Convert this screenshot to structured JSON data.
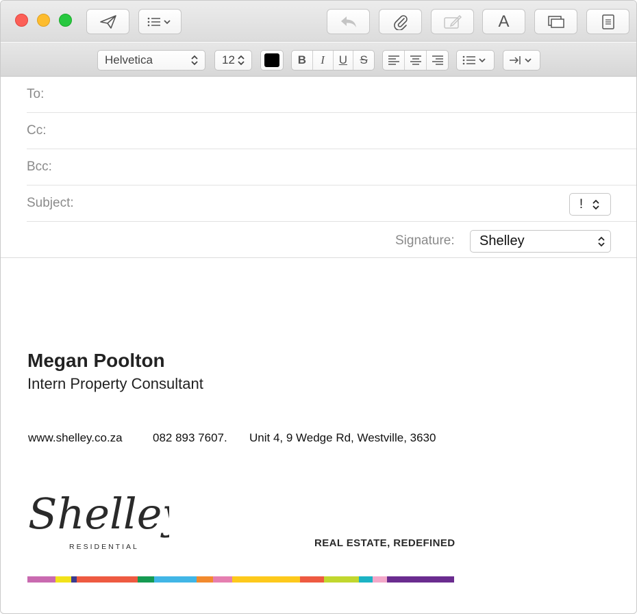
{
  "window": {
    "toolbar": {
      "buttons": [
        {
          "name": "send-button",
          "icon": "paper-plane-icon"
        },
        {
          "name": "header-fields-button",
          "icon": "list-icon"
        },
        {
          "name": "reply-button",
          "icon": "reply-arrow-icon"
        },
        {
          "name": "attach-button",
          "icon": "paperclip-icon"
        },
        {
          "name": "markup-button",
          "icon": "markup-icon"
        },
        {
          "name": "fonts-button",
          "icon": "font-a-icon"
        },
        {
          "name": "browse-photos-button",
          "icon": "photo-browser-icon"
        },
        {
          "name": "stationery-button",
          "icon": "stationery-icon"
        }
      ],
      "fonts_label": "A"
    }
  },
  "format": {
    "font": "Helvetica",
    "size": "12",
    "text_color": "#000000",
    "bold": "B",
    "italic": "I",
    "underline": "U",
    "strike": "S"
  },
  "header": {
    "to_label": "To:",
    "cc_label": "Cc:",
    "bcc_label": "Bcc:",
    "subject_label": "Subject:",
    "priority": "!",
    "signature_label": "Signature:",
    "signature_value": "Shelley"
  },
  "body": {
    "name": "Megan Poolton",
    "title": "Intern Property Consultant",
    "website": "www.shelley.co.za",
    "phone": "082 893 7607.",
    "address": "Unit 4, 9 Wedge Rd, Westville, 3630",
    "logo_text": "Shelley",
    "logo_subtext": "RESIDENTIAL",
    "tagline": "REAL ESTATE, REDEFINED",
    "color_stripe": [
      "#c96ab0",
      "#f2e21a",
      "#3b3b8f",
      "#ee5a41",
      "#159a52",
      "#41b6e6",
      "#f28a2e",
      "#e57fb0",
      "#fdc91c",
      "#ee5a41",
      "#c1d72e",
      "#1bb3c4",
      "#f3a8c9",
      "#6a2c8f"
    ]
  }
}
